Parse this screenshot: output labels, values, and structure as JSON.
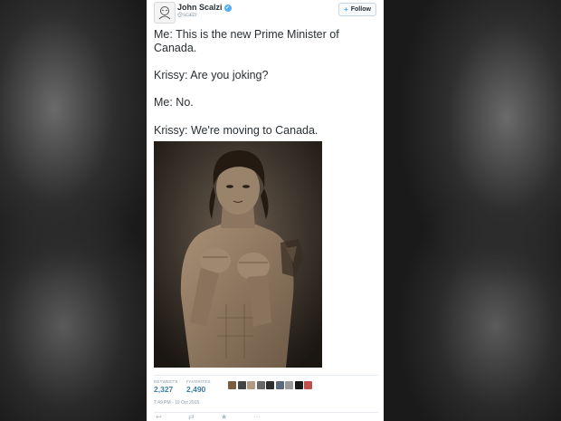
{
  "tweet": {
    "author_name": "John Scalzi",
    "author_handle": "@scalzi",
    "follow_label": "Follow",
    "lines": [
      "Me: This is the new Prime Minister of Canada.",
      "Krissy: Are you joking?",
      "Me: No.",
      "Krissy: We're moving to Canada."
    ],
    "retweets_label": "RETWEETS",
    "retweets_count": "2,327",
    "favorites_label": "FAVORITES",
    "favorites_count": "2,490",
    "timestamp": "7:49 PM - 19 Oct 2015"
  },
  "icons": {
    "avatar": "scalzi-avatar-icon",
    "verified": "verified-badge-icon",
    "follow": "follow-user-icon",
    "reply": "reply-icon",
    "retweet": "retweet-icon",
    "favorite": "favorite-star-icon",
    "more": "more-dots-icon"
  },
  "colors": {
    "accent": "#55acee",
    "count": "#3b7ea1",
    "text": "#292f33",
    "muted": "#8899a6"
  }
}
